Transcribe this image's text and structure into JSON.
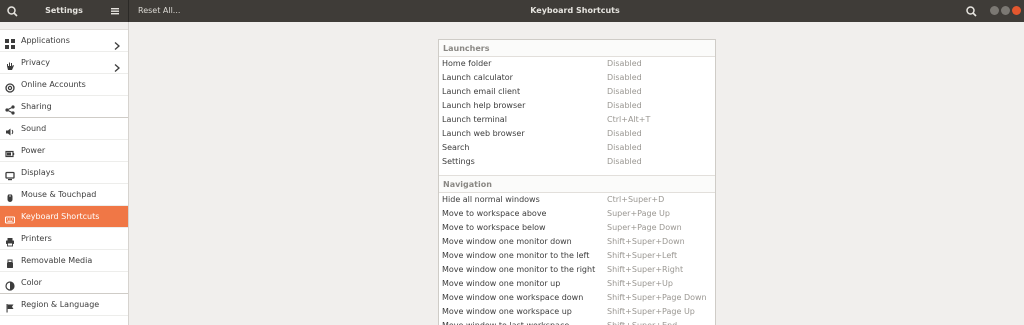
{
  "header": {
    "sidebar_title": "Settings",
    "reset_label": "Reset All...",
    "title": "Keyboard Shortcuts"
  },
  "sidebar": {
    "items": [
      {
        "label": "Applications",
        "icon": "applications-grid-icon",
        "chevron": true
      },
      {
        "label": "Privacy",
        "icon": "privacy-hand-icon",
        "chevron": true
      },
      {
        "label": "Online Accounts",
        "icon": "at-sign-icon",
        "chevron": false
      },
      {
        "label": "Sharing",
        "icon": "share-icon",
        "chevron": false
      },
      {
        "label": "Sound",
        "icon": "speaker-icon",
        "chevron": false
      },
      {
        "label": "Power",
        "icon": "power-icon",
        "chevron": false
      },
      {
        "label": "Displays",
        "icon": "display-icon",
        "chevron": false
      },
      {
        "label": "Mouse & Touchpad",
        "icon": "mouse-icon",
        "chevron": false
      },
      {
        "label": "Keyboard Shortcuts",
        "icon": "keyboard-icon",
        "chevron": false,
        "active": true
      },
      {
        "label": "Printers",
        "icon": "printer-icon",
        "chevron": false
      },
      {
        "label": "Removable Media",
        "icon": "usb-icon",
        "chevron": false
      },
      {
        "label": "Color",
        "icon": "color-palette-icon",
        "chevron": false
      },
      {
        "label": "Region & Language",
        "icon": "flag-icon",
        "chevron": false
      }
    ]
  },
  "shortcuts": {
    "launchers": {
      "heading": "Launchers",
      "rows": [
        {
          "name": "Home folder",
          "accel": "Disabled"
        },
        {
          "name": "Launch calculator",
          "accel": "Disabled"
        },
        {
          "name": "Launch email client",
          "accel": "Disabled"
        },
        {
          "name": "Launch help browser",
          "accel": "Disabled"
        },
        {
          "name": "Launch terminal",
          "accel": "Ctrl+Alt+T"
        },
        {
          "name": "Launch web browser",
          "accel": "Disabled"
        },
        {
          "name": "Search",
          "accel": "Disabled"
        },
        {
          "name": "Settings",
          "accel": "Disabled"
        }
      ]
    },
    "navigation": {
      "heading": "Navigation",
      "rows": [
        {
          "name": "Hide all normal windows",
          "accel": "Ctrl+Super+D"
        },
        {
          "name": "Move to workspace above",
          "accel": "Super+Page Up"
        },
        {
          "name": "Move to workspace below",
          "accel": "Super+Page Down"
        },
        {
          "name": "Move window one monitor down",
          "accel": "Shift+Super+Down"
        },
        {
          "name": "Move window one monitor to the left",
          "accel": "Shift+Super+Left"
        },
        {
          "name": "Move window one monitor to the right",
          "accel": "Shift+Super+Right"
        },
        {
          "name": "Move window one monitor up",
          "accel": "Shift+Super+Up"
        },
        {
          "name": "Move window one workspace down",
          "accel": "Shift+Super+Page Down"
        },
        {
          "name": "Move window one workspace up",
          "accel": "Shift+Super+Page Up"
        },
        {
          "name": "Move window to last workspace",
          "accel": "Shift+Super+End"
        }
      ]
    }
  },
  "colors": {
    "accent": "#f07746",
    "headerbar": "#3f3c38",
    "close_button": "#e4572e"
  }
}
